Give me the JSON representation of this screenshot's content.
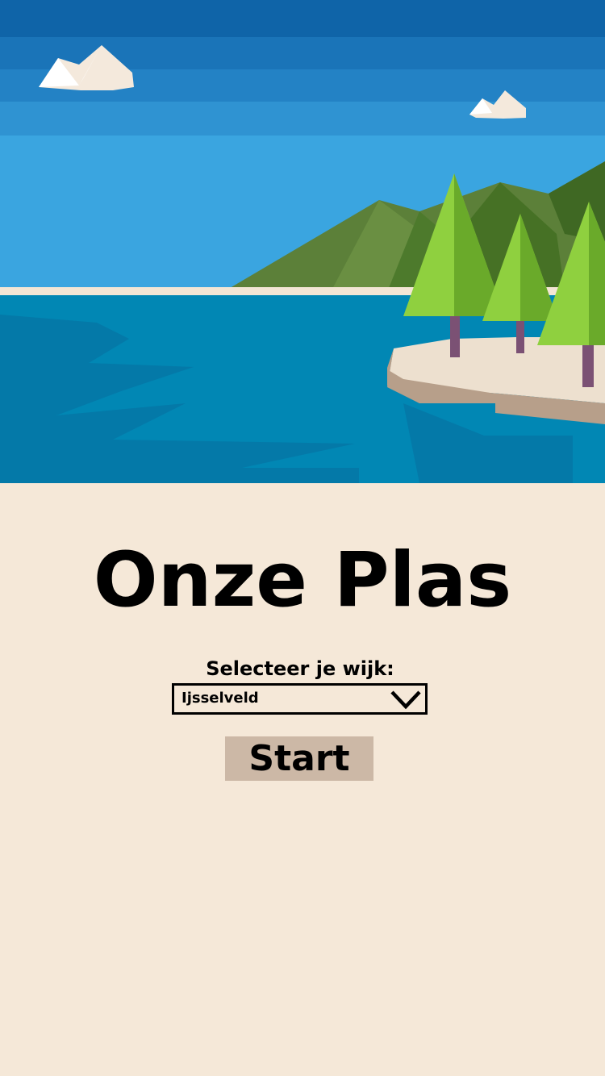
{
  "app": {
    "title": "Onze Plas"
  },
  "form": {
    "select_label": "Selecteer je wijk:",
    "selected_wijk": "Ijsselveld",
    "start_label": "Start"
  },
  "icons": {
    "dropdown": "chevron-down-icon"
  },
  "colors": {
    "background": "#f5e8d8",
    "button": "#ccb8a6",
    "sky_top": "#0f64a8",
    "sky_bottom": "#3da6e0",
    "water": "#0187b4",
    "tree": "#8fd03f",
    "sand": "#ede0cf"
  }
}
